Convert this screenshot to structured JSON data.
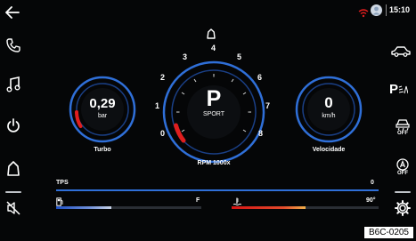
{
  "status": {
    "time": "15:10"
  },
  "gauges": {
    "turbo": {
      "value": "0,29",
      "unit": "bar",
      "label": "Turbo"
    },
    "speed": {
      "value": "0",
      "unit": "km/h",
      "label": "Velocidade"
    },
    "rpm": {
      "gear": "P",
      "mode": "SPORT",
      "label": "RPM 1000x",
      "ticks": [
        "0",
        "1",
        "2",
        "3",
        "4",
        "5",
        "6",
        "7",
        "8"
      ]
    }
  },
  "bars": {
    "tps": {
      "label": "TPS",
      "value": "0"
    },
    "fuel": {
      "end_label": "F",
      "level": 0.38
    },
    "temp": {
      "end_label": "90°",
      "level": 0.5
    }
  },
  "right_icons": {
    "traction_off": "OFF",
    "autohold_off": "OFF",
    "park_assist": "P"
  },
  "image_code": "B6C-0205",
  "colors": {
    "accent_blue": "#2f6fd8",
    "warning_red": "#e01e1e",
    "background": "#050607"
  }
}
